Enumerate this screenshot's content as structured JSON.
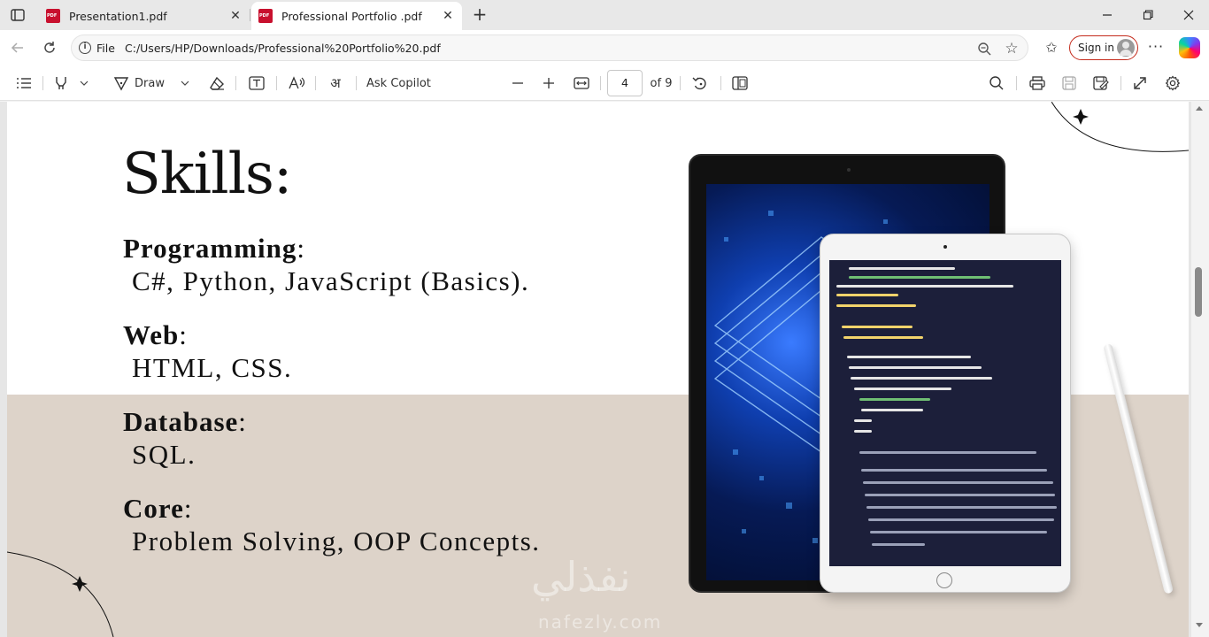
{
  "tabs": [
    {
      "label": "Presentation1.pdf",
      "active": false
    },
    {
      "label": "Professional Portfolio .pdf",
      "active": true
    }
  ],
  "address": {
    "scheme_label": "File",
    "url": "C:/Users/HP/Downloads/Professional%20Portfolio%20.pdf"
  },
  "account": {
    "signin_label": "Sign in"
  },
  "pdf_toolbar": {
    "draw_label": "Draw",
    "ask_copilot_label": "Ask Copilot",
    "current_page": "4",
    "page_total_label": "of 9"
  },
  "document": {
    "title": "Skills:",
    "sections": [
      {
        "heading": "Programming",
        "value": "C#, Python, JavaScript (Basics)."
      },
      {
        "heading": "Web",
        "value": "HTML, CSS."
      },
      {
        "heading": "Database",
        "value": "SQL."
      },
      {
        "heading": "Core",
        "value": "Problem Solving, OOP Concepts."
      }
    ],
    "watermark": "نفذلي",
    "watermark_sub": "nafezly.com"
  },
  "colors": {
    "accent_red": "#c42b1c",
    "page_beige": "#ddd3c9"
  }
}
